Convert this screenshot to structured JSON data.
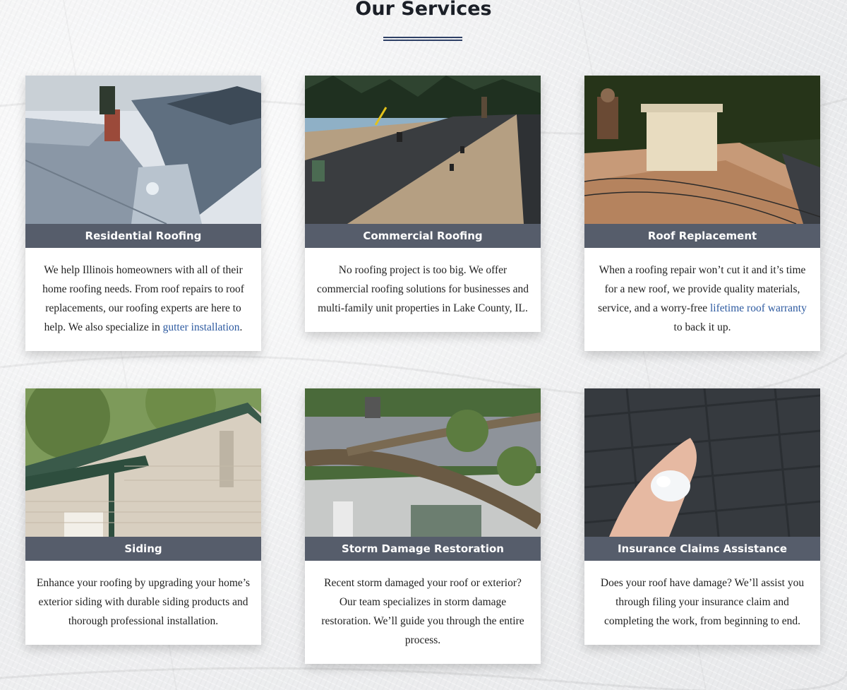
{
  "section": {
    "title": "Our Services"
  },
  "colors": {
    "label_bar": "#565d6b",
    "link": "#2d5aa0",
    "accent_line": "#2e4066"
  },
  "cards": [
    {
      "title": "Residential Roofing",
      "image_alt": "Aerial view of residential rooftops with grey shingles in winter",
      "text_before": "We help Illinois homeowners with all of their home roofing needs. From roof repairs to roof replacements, our roofing experts are here to help. We also specialize in ",
      "link": "gutter installation",
      "text_after": "."
    },
    {
      "title": "Commercial Roofing",
      "image_alt": "Flat commercial roof under membrane installation",
      "text_before": "No roofing project is too big. We offer commercial roofing solutions for businesses and multi-family unit properties in Lake County, IL.",
      "link": "",
      "text_after": ""
    },
    {
      "title": "Roof Replacement",
      "image_alt": "Workers replacing roof decking around a chimney",
      "text_before": "When a roofing repair won’t cut it and it’s time for a new roof, we provide quality materials, service, and a worry-free ",
      "link": "lifetime roof warranty",
      "text_after": " to back it up."
    },
    {
      "title": "Siding",
      "image_alt": "House exterior with beige siding and green gutter",
      "text_before": "Enhance your roofing by upgrading your home’s exterior siding with durable siding products and thorough professional installation.",
      "link": "",
      "text_after": ""
    },
    {
      "title": "Storm Damage Restoration",
      "image_alt": "Fallen tree resting on a damaged house roof",
      "text_before": "Recent storm damaged your roof or exterior? Our team specializes in storm damage restoration. We’ll guide you through the entire process.",
      "link": "",
      "text_after": ""
    },
    {
      "title": "Insurance Claims Assistance",
      "image_alt": "Hand holding hailstones over dark roof shingles",
      "text_before": "Does your roof have damage? We’ll assist you through filing your insurance claim and completing the work, from beginning to end.",
      "link": "",
      "text_after": ""
    }
  ]
}
